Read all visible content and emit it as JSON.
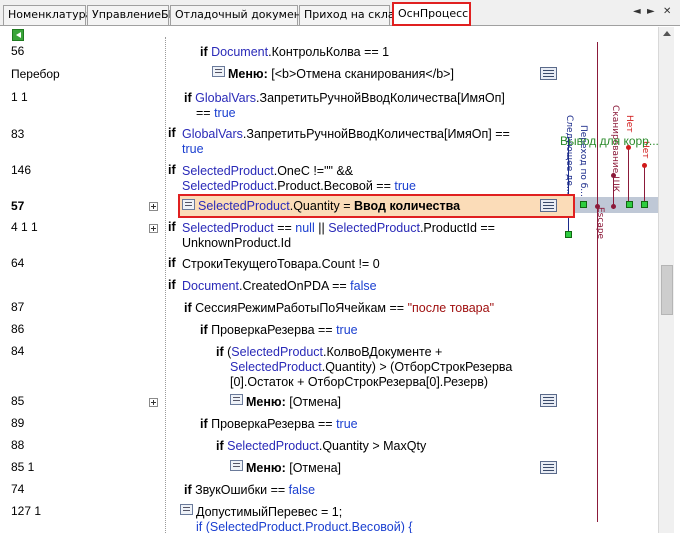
{
  "tabs": [
    {
      "label": "Номенклатура"
    },
    {
      "label": "УправлениеБП"
    },
    {
      "label": "Отладочный документ"
    },
    {
      "label": "Приход на склад"
    },
    {
      "label": "ОснПроцесс",
      "active": true
    }
  ],
  "tab_controls": {
    "prev": "◄",
    "next": "►",
    "close": "✕"
  },
  "rows": [
    {
      "num": "56"
    },
    {
      "num": "Перебор"
    },
    {
      "num": "1 1"
    },
    {
      "num": "83"
    },
    {
      "num": "146"
    },
    {
      "num": "57",
      "bold": true
    },
    {
      "num": "4 1 1"
    },
    {
      "num": "64"
    },
    {
      "num": "87"
    },
    {
      "num": "86"
    },
    {
      "num": "84"
    },
    {
      "num": "85"
    },
    {
      "num": "89"
    },
    {
      "num": "88"
    },
    {
      "num": "85 1"
    },
    {
      "num": "74"
    },
    {
      "num": "127 1"
    }
  ],
  "code": {
    "if": "if",
    "eq1": " == 1",
    "menu": "Меню:",
    "menu1_val": " [<b>Отмена сканирования</b>]",
    "document": "Document",
    "kontrol": ".КонтрольКолва",
    "globalvars": "GlobalVars",
    "zapret_a": ".ЗапретитьРучнойВводКоличества[ИмяОп]",
    "eq_true": "== ",
    "true": "true",
    "false": "false",
    "null": "null",
    "zapret_b": ".ЗапретитьРучнойВводКоличества[ИмяОп] ==",
    "selected_product": "SelectedProduct",
    "onec": ".OneC !=\"\" &&",
    "product_vesovoy": ".Product.Весовой == ",
    "quantity": ".Quantity",
    "vvod_eq": " = ",
    "vvod": "Ввод количества",
    "eq_null_or": " == ",
    "or": " || ",
    "productid_eq": ".ProductId ==",
    "unknown": "UnknownProduct.Id",
    "stroki": "СтрокиТекущегоТовара.Count != 0",
    "created": ".CreatedOnPDA == ",
    "sessiya": "СессияРежимРаботыПоЯчейкам == ",
    "posle": "\"после товара\"",
    "proverka": "ПроверкаРезерва == ",
    "kolvo_a": ".КолвоВДокументе +",
    "kolvo_b": ".Quantity) > (ОтборСтрокРезерва",
    "kolvo_c": "[0].Остаток + ОтборСтрокРезерва[0].Резерв)",
    "otmena": " [Отмена]",
    "maxqty": ".Quantity > MaxQty",
    "zvuk": "ЗвукОшибки == ",
    "dopust": "ДопустимыйПеревес = 1;",
    "last_line": "if (SelectedProduct.Product.Весовой) {",
    "lparen": "(",
    "lparen_sp": "(SelectedProduct"
  },
  "side_labels": {
    "lbl1": "Следующее де...",
    "lbl2": "Переход по б...",
    "lbl3": "Сканирование ШК",
    "lbl4": "Нет",
    "lbl5": "Нет",
    "escape": "Escape",
    "green": "Вывод для корр..."
  },
  "colors": {
    "highlight_bg": "#fbdcb8",
    "highlight_border": "#e02020",
    "flow_line": "#8b1a3a",
    "node": "#2ecc40"
  }
}
